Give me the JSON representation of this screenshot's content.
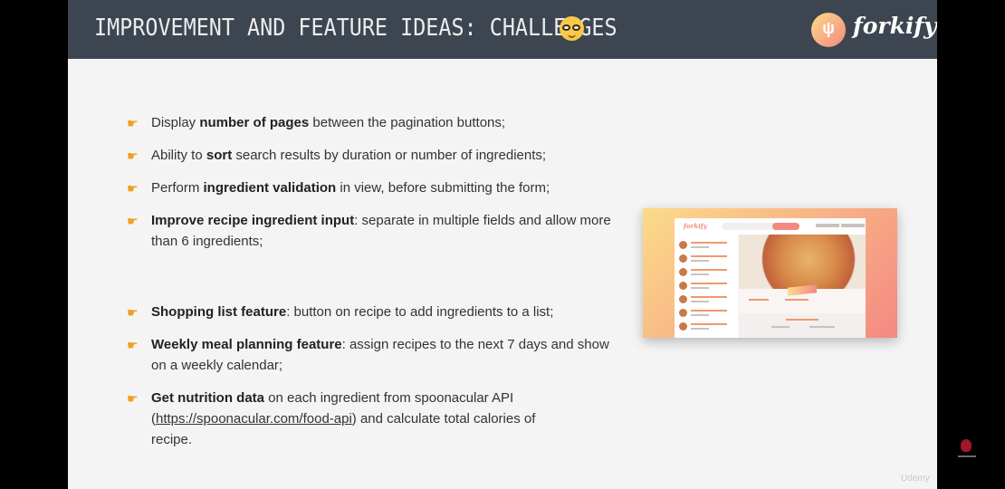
{
  "header": {
    "title": "IMPROVEMENT AND FEATURE IDEAS: CHALLENGES",
    "emoji_icon": "nerd-face-icon",
    "logo_text": "forkify",
    "logo_icon": "fork-knife-icon"
  },
  "bullets": [
    {
      "pre": "Display ",
      "bold": "number of pages",
      "post": " between the pagination buttons;"
    },
    {
      "pre": "Ability to ",
      "bold": "sort",
      "post": " search results by duration or number of ingredients;"
    },
    {
      "pre": "Perform ",
      "bold": "ingredient validation",
      "post": " in view, before submitting the form;"
    },
    {
      "pre": "",
      "bold": "Improve recipe ingredient input",
      "post": ": separate in multiple fields and allow more than 6 ingredients;"
    },
    {
      "pre": "",
      "bold": "Shopping list feature",
      "post": ": button on recipe to add ingredients to a list;"
    },
    {
      "pre": "",
      "bold": "Weekly meal planning feature",
      "post": ": assign recipes to the next 7 days and show on a weekly calendar;"
    },
    {
      "pre": "",
      "bold": "Get nutrition data",
      "post": " on each ingredient from spoonacular API (",
      "link": "https://spoonacular.com/food-api",
      "post2": ") and calculate total calories of recipe."
    }
  ],
  "hand_icon": "pointing-hand-icon",
  "footer": {
    "udemy": "Udemy"
  },
  "colors": {
    "header_bg": "#3d4550",
    "slide_bg": "#f4f4f4",
    "accent_from": "#fbdb89",
    "accent_to": "#f48982",
    "hand": "#f0a020"
  }
}
